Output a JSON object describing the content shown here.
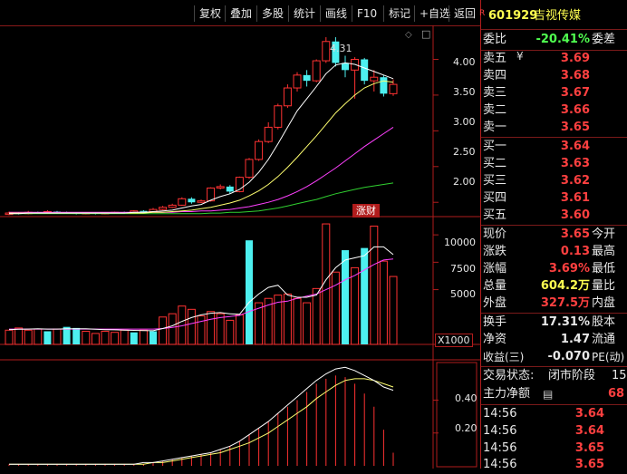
{
  "toolbar": {
    "buttons": [
      {
        "label": "复权"
      },
      {
        "label": "叠加"
      },
      {
        "label": "多股"
      },
      {
        "label": "统计"
      },
      {
        "label": "画线"
      },
      {
        "label": "F10"
      },
      {
        "label": "标记"
      },
      {
        "label": "+自选"
      },
      {
        "label": "返回"
      }
    ]
  },
  "stock": {
    "badge": "R",
    "code": "601929",
    "name": "吉视传媒"
  },
  "main_chart": {
    "max_price_label": "4.31",
    "event_tag": "涨财",
    "price_ticks": [
      "4.00",
      "3.50",
      "3.00",
      "2.50",
      "2.00"
    ]
  },
  "volume_chart": {
    "ticks": [
      "10000",
      "7500",
      "5000"
    ],
    "unit_label": "X1000"
  },
  "indicator_chart": {
    "ticks": [
      "0.40",
      "0.20"
    ]
  },
  "quote": {
    "weibi": {
      "label": "委比",
      "value": "-20.41%",
      "label2": "委差"
    },
    "asks": [
      {
        "label": "卖五",
        "price": "3.69",
        "mark": "¥"
      },
      {
        "label": "卖四",
        "price": "3.68"
      },
      {
        "label": "卖三",
        "price": "3.67"
      },
      {
        "label": "卖二",
        "price": "3.66"
      },
      {
        "label": "卖一",
        "price": "3.65"
      }
    ],
    "bids": [
      {
        "label": "买一",
        "price": "3.64"
      },
      {
        "label": "买二",
        "price": "3.63"
      },
      {
        "label": "买三",
        "price": "3.62"
      },
      {
        "label": "买四",
        "price": "3.61"
      },
      {
        "label": "买五",
        "price": "3.60"
      }
    ],
    "stats": [
      {
        "label": "现价",
        "value": "3.65",
        "label2": "今开"
      },
      {
        "label": "涨跌",
        "value": "0.13",
        "label2": "最高"
      },
      {
        "label": "涨幅",
        "value": "3.69%",
        "label2": "最低"
      },
      {
        "label": "总量",
        "value": "604.2万",
        "label2": "量比"
      },
      {
        "label": "外盘",
        "value": "327.5万",
        "label2": "内盘"
      }
    ],
    "fund": [
      {
        "label": "换手",
        "value": "17.31%",
        "label2": "股本"
      },
      {
        "label": "净资",
        "value": "1.47",
        "label2": "流通"
      },
      {
        "label": "收益(三)",
        "value": "-0.070",
        "label2": "PE(动)"
      }
    ],
    "status": {
      "label": "交易状态:",
      "value": "闭市阶段",
      "extra": "15:"
    },
    "main_flow": {
      "label": "主力净额",
      "value": "68"
    },
    "ticks": [
      {
        "time": "14:56",
        "price": "3.64"
      },
      {
        "time": "14:56",
        "price": "3.64"
      },
      {
        "time": "14:56",
        "price": "3.65"
      },
      {
        "time": "14:56",
        "price": "3.65"
      }
    ]
  },
  "chart_data": {
    "type": "candlestick",
    "price_axis": {
      "ticks": [
        4.0,
        3.5,
        3.0,
        2.5,
        2.0
      ],
      "ylim": [
        1.8,
        4.45
      ]
    },
    "candles": [
      {
        "o": 1.83,
        "c": 1.85,
        "h": 1.87,
        "l": 1.82,
        "up": true
      },
      {
        "o": 1.85,
        "c": 1.84,
        "h": 1.86,
        "l": 1.83,
        "up": false
      },
      {
        "o": 1.84,
        "c": 1.86,
        "h": 1.88,
        "l": 1.83,
        "up": true
      },
      {
        "o": 1.86,
        "c": 1.85,
        "h": 1.87,
        "l": 1.84,
        "up": false
      },
      {
        "o": 1.85,
        "c": 1.87,
        "h": 1.89,
        "l": 1.84,
        "up": true
      },
      {
        "o": 1.87,
        "c": 1.86,
        "h": 1.88,
        "l": 1.85,
        "up": false
      },
      {
        "o": 1.86,
        "c": 1.85,
        "h": 1.87,
        "l": 1.84,
        "up": false
      },
      {
        "o": 1.85,
        "c": 1.84,
        "h": 1.86,
        "l": 1.83,
        "up": false
      },
      {
        "o": 1.84,
        "c": 1.85,
        "h": 1.86,
        "l": 1.83,
        "up": true
      },
      {
        "o": 1.85,
        "c": 1.84,
        "h": 1.86,
        "l": 1.83,
        "up": false
      },
      {
        "o": 1.84,
        "c": 1.85,
        "h": 1.86,
        "l": 1.83,
        "up": true
      },
      {
        "o": 1.85,
        "c": 1.86,
        "h": 1.87,
        "l": 1.84,
        "up": true
      },
      {
        "o": 1.86,
        "c": 1.85,
        "h": 1.87,
        "l": 1.84,
        "up": false
      },
      {
        "o": 1.85,
        "c": 1.88,
        "h": 1.89,
        "l": 1.84,
        "up": true
      },
      {
        "o": 1.88,
        "c": 1.87,
        "h": 1.89,
        "l": 1.86,
        "up": false
      },
      {
        "o": 1.87,
        "c": 1.9,
        "h": 1.92,
        "l": 1.86,
        "up": true
      },
      {
        "o": 1.9,
        "c": 1.93,
        "h": 1.95,
        "l": 1.89,
        "up": true
      },
      {
        "o": 1.93,
        "c": 1.96,
        "h": 1.98,
        "l": 1.92,
        "up": true
      },
      {
        "o": 1.96,
        "c": 2.05,
        "h": 2.07,
        "l": 1.95,
        "up": true
      },
      {
        "o": 2.05,
        "c": 2.0,
        "h": 2.07,
        "l": 1.98,
        "up": false
      },
      {
        "o": 2.0,
        "c": 2.02,
        "h": 2.04,
        "l": 1.99,
        "up": true
      },
      {
        "o": 2.02,
        "c": 2.2,
        "h": 2.21,
        "l": 2.01,
        "up": true
      },
      {
        "o": 2.2,
        "c": 2.22,
        "h": 2.25,
        "l": 2.18,
        "up": true
      },
      {
        "o": 2.22,
        "c": 2.15,
        "h": 2.24,
        "l": 2.12,
        "up": false
      },
      {
        "o": 2.15,
        "c": 2.35,
        "h": 2.36,
        "l": 2.14,
        "up": true
      },
      {
        "o": 2.35,
        "c": 2.6,
        "h": 2.62,
        "l": 2.33,
        "up": true
      },
      {
        "o": 2.6,
        "c": 2.85,
        "h": 2.88,
        "l": 2.58,
        "up": true
      },
      {
        "o": 2.85,
        "c": 3.05,
        "h": 3.12,
        "l": 2.83,
        "up": true
      },
      {
        "o": 3.05,
        "c": 3.35,
        "h": 3.38,
        "l": 3.02,
        "up": true
      },
      {
        "o": 3.35,
        "c": 3.6,
        "h": 3.65,
        "l": 3.32,
        "up": true
      },
      {
        "o": 3.6,
        "c": 3.78,
        "h": 3.82,
        "l": 3.55,
        "up": true
      },
      {
        "o": 3.78,
        "c": 3.7,
        "h": 3.85,
        "l": 3.62,
        "up": false
      },
      {
        "o": 3.7,
        "c": 3.98,
        "h": 4.0,
        "l": 3.68,
        "up": true
      },
      {
        "o": 3.98,
        "c": 4.25,
        "h": 4.31,
        "l": 3.95,
        "up": true
      },
      {
        "o": 4.25,
        "c": 3.95,
        "h": 4.31,
        "l": 3.9,
        "up": false
      },
      {
        "o": 3.95,
        "c": 3.85,
        "h": 4.05,
        "l": 3.75,
        "up": false
      },
      {
        "o": 3.85,
        "c": 4.0,
        "h": 4.03,
        "l": 3.45,
        "up": true
      },
      {
        "o": 4.0,
        "c": 3.7,
        "h": 4.02,
        "l": 3.65,
        "up": false
      },
      {
        "o": 3.7,
        "c": 3.75,
        "h": 3.85,
        "l": 3.55,
        "up": true
      },
      {
        "o": 3.75,
        "c": 3.52,
        "h": 3.78,
        "l": 3.48,
        "up": false
      },
      {
        "o": 3.52,
        "c": 3.65,
        "h": 3.72,
        "l": 3.49,
        "up": true
      }
    ],
    "ma_fast": [
      1.84,
      1.84,
      1.85,
      1.85,
      1.85,
      1.85,
      1.85,
      1.85,
      1.85,
      1.85,
      1.85,
      1.85,
      1.85,
      1.86,
      1.86,
      1.87,
      1.88,
      1.89,
      1.92,
      1.95,
      1.97,
      2.03,
      2.08,
      2.12,
      2.18,
      2.28,
      2.42,
      2.6,
      2.82,
      3.05,
      3.28,
      3.45,
      3.62,
      3.8,
      3.92,
      3.95,
      3.93,
      3.88,
      3.83,
      3.78,
      3.73
    ],
    "ma_mid": [
      1.85,
      1.85,
      1.85,
      1.85,
      1.85,
      1.85,
      1.85,
      1.85,
      1.85,
      1.85,
      1.85,
      1.85,
      1.85,
      1.85,
      1.85,
      1.86,
      1.86,
      1.87,
      1.88,
      1.89,
      1.91,
      1.93,
      1.96,
      1.99,
      2.03,
      2.09,
      2.16,
      2.25,
      2.36,
      2.49,
      2.63,
      2.78,
      2.93,
      3.09,
      3.25,
      3.38,
      3.5,
      3.6,
      3.66,
      3.7,
      3.68
    ],
    "ma_slow": [
      1.86,
      1.86,
      1.86,
      1.86,
      1.86,
      1.86,
      1.86,
      1.86,
      1.86,
      1.86,
      1.86,
      1.86,
      1.86,
      1.86,
      1.86,
      1.86,
      1.86,
      1.86,
      1.87,
      1.87,
      1.88,
      1.88,
      1.89,
      1.9,
      1.92,
      1.94,
      1.97,
      2.0,
      2.04,
      2.09,
      2.15,
      2.22,
      2.3,
      2.39,
      2.48,
      2.58,
      2.68,
      2.78,
      2.87,
      2.96,
      3.05
    ],
    "ma_long": [
      1.84,
      1.84,
      1.84,
      1.84,
      1.84,
      1.84,
      1.84,
      1.84,
      1.84,
      1.84,
      1.84,
      1.84,
      1.84,
      1.84,
      1.84,
      1.84,
      1.84,
      1.84,
      1.84,
      1.84,
      1.84,
      1.85,
      1.85,
      1.86,
      1.86,
      1.87,
      1.88,
      1.9,
      1.92,
      1.95,
      1.98,
      2.01,
      2.04,
      2.08,
      2.12,
      2.15,
      2.18,
      2.21,
      2.23,
      2.25,
      2.27
    ],
    "volume": {
      "ylim": [
        0,
        11500
      ],
      "ticks": [
        10000,
        7500,
        5000
      ],
      "values": [
        1300,
        1500,
        1300,
        1400,
        1200,
        1400,
        1600,
        1500,
        1200,
        1000,
        1200,
        1100,
        1300,
        1100,
        1300,
        1200,
        2500,
        2800,
        3500,
        3200,
        2600,
        3000,
        2800,
        2200,
        2700,
        9500,
        3800,
        4200,
        4500,
        4600,
        4200,
        3800,
        5100,
        11000,
        6600,
        8600,
        7000,
        8800,
        10800,
        7600,
        6200
      ],
      "ma1": [
        1350,
        1380,
        1400,
        1420,
        1400,
        1400,
        1420,
        1430,
        1420,
        1380,
        1350,
        1330,
        1300,
        1280,
        1260,
        1250,
        1450,
        1700,
        2100,
        2450,
        2700,
        2850,
        2900,
        2800,
        2750,
        3850,
        4600,
        5200,
        5400,
        4500,
        4300,
        4300,
        4500,
        5900,
        7000,
        7700,
        7900,
        8100,
        8900,
        8900,
        8200
      ],
      "ma2": [
        1400,
        1400,
        1400,
        1400,
        1400,
        1400,
        1400,
        1400,
        1400,
        1400,
        1400,
        1400,
        1400,
        1400,
        1400,
        1400,
        1450,
        1550,
        1700,
        1900,
        2100,
        2300,
        2450,
        2550,
        2650,
        3000,
        3300,
        3600,
        3850,
        3950,
        4200,
        4400,
        4600,
        5000,
        5400,
        5900,
        6300,
        6800,
        7300,
        7700,
        7800
      ],
      "hollow": [
        true,
        true,
        true,
        true,
        false,
        true,
        false,
        false,
        true,
        true,
        true,
        true,
        true,
        false,
        true,
        false,
        true,
        true,
        true,
        true,
        true,
        true,
        true,
        true,
        true,
        false,
        true,
        true,
        true,
        true,
        true,
        true,
        true,
        true,
        true,
        false,
        true,
        false,
        true,
        true,
        true
      ]
    },
    "indicator": {
      "ylim": [
        0,
        0.64
      ],
      "ticks": [
        0.4,
        0.2
      ],
      "bars": [
        0.01,
        0.01,
        0.01,
        0.01,
        0.01,
        0.01,
        0.01,
        0.01,
        0.01,
        0.01,
        0.01,
        0.01,
        0.01,
        0.01,
        0.01,
        0.02,
        0.03,
        0.04,
        0.05,
        0.06,
        0.07,
        0.08,
        0.1,
        0.12,
        0.15,
        0.19,
        0.23,
        0.27,
        0.32,
        0.36,
        0.4,
        0.45,
        0.5,
        0.53,
        0.55,
        0.54,
        0.5,
        0.44,
        0.36,
        0.22,
        0.08
      ],
      "line_white": [
        0.01,
        0.01,
        0.01,
        0.01,
        0.01,
        0.01,
        0.01,
        0.01,
        0.01,
        0.01,
        0.01,
        0.01,
        0.01,
        0.01,
        0.02,
        0.02,
        0.03,
        0.04,
        0.05,
        0.06,
        0.07,
        0.08,
        0.1,
        0.12,
        0.15,
        0.19,
        0.23,
        0.27,
        0.32,
        0.37,
        0.42,
        0.47,
        0.52,
        0.56,
        0.59,
        0.6,
        0.58,
        0.55,
        0.52,
        0.48,
        0.46
      ],
      "line_yellow": [
        0.01,
        0.01,
        0.01,
        0.01,
        0.01,
        0.01,
        0.01,
        0.01,
        0.01,
        0.01,
        0.01,
        0.01,
        0.01,
        0.01,
        0.01,
        0.02,
        0.02,
        0.03,
        0.04,
        0.05,
        0.06,
        0.07,
        0.08,
        0.1,
        0.12,
        0.14,
        0.17,
        0.2,
        0.24,
        0.28,
        0.32,
        0.36,
        0.41,
        0.45,
        0.49,
        0.52,
        0.53,
        0.53,
        0.52,
        0.5,
        0.48
      ]
    },
    "colors": {
      "up": "#ff3232",
      "down": "#4df0f0",
      "ma_fast": "#ffffff",
      "ma_mid": "#ffff70",
      "ma_slow": "#ff40ff",
      "ma_long": "#30d030",
      "axis": "#b01c1c"
    }
  }
}
